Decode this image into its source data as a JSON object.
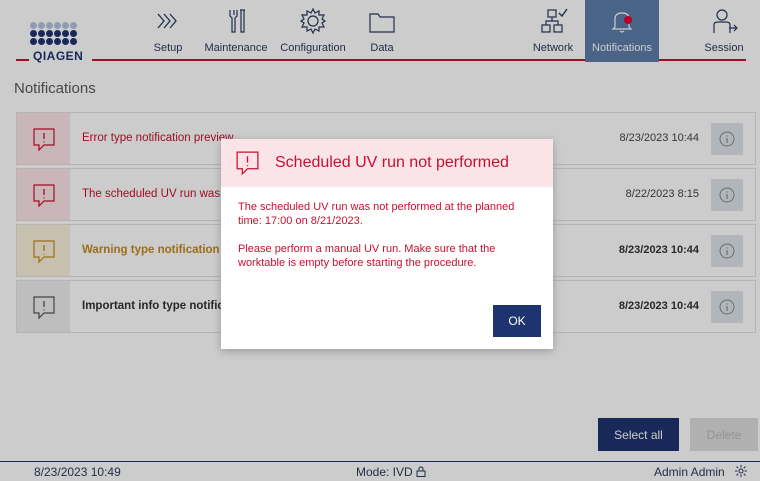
{
  "app": {
    "logo_text": "QIAGEN"
  },
  "nav": {
    "setup": "Setup",
    "maintenance": "Maintenance",
    "configuration": "Configuration",
    "data": "Data",
    "network": "Network",
    "notifications": "Notifications",
    "session": "Session"
  },
  "page": {
    "title": "Notifications"
  },
  "notifications": [
    {
      "type": "error",
      "message": "Error type notification preview",
      "date": "8/23/2023 10:44"
    },
    {
      "type": "error",
      "message": "The scheduled UV run was not performed",
      "date": "8/22/2023 8:15"
    },
    {
      "type": "warning",
      "message": "Warning type notification preview",
      "date": "8/23/2023 10:44"
    },
    {
      "type": "info",
      "message": "Important info type notification preview",
      "date": "8/23/2023 10:44"
    }
  ],
  "buttons": {
    "select_all": "Select all",
    "delete": "Delete"
  },
  "status_bar": {
    "datetime": "8/23/2023 10:49",
    "mode": "Mode: IVD",
    "user": "Admin Admin"
  },
  "dialog": {
    "title": "Scheduled UV run not performed",
    "body1": "The scheduled UV run was not performed at the planned time: 17:00 on 8/21/2023.",
    "body2": "Please perform a manual UV run. Make sure that the worktable is empty before starting the procedure.",
    "ok_label": "OK"
  },
  "colors": {
    "brand_navy": "#1e3470",
    "brand_red": "#c8102e",
    "active_tab": "#5d7eab",
    "warning": "#c48a1c"
  }
}
